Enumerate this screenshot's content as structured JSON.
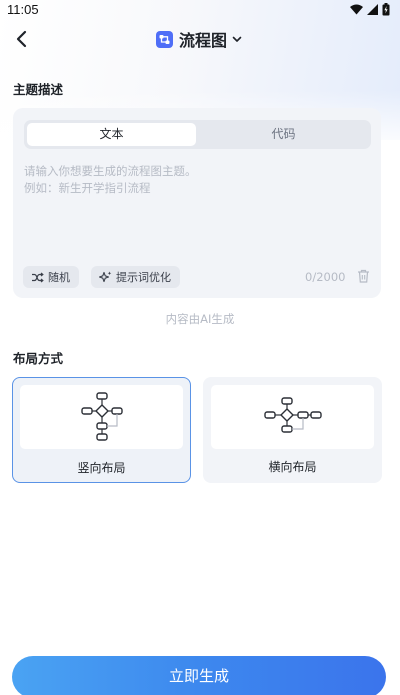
{
  "status_bar": {
    "time": "11:05"
  },
  "header": {
    "title": "流程图"
  },
  "topic": {
    "section_title": "主题描述",
    "tabs": [
      {
        "label": "文本"
      },
      {
        "label": "代码"
      }
    ],
    "placeholder_line1": "请输入你想要生成的流程图主题。",
    "placeholder_line2": "例如：新生开学指引流程",
    "chips": {
      "random": "随机",
      "optimize": "提示词优化"
    },
    "counter": "0/2000",
    "ai_note": "内容由AI生成"
  },
  "layout": {
    "section_title": "布局方式",
    "options": [
      {
        "label": "竖向布局"
      },
      {
        "label": "横向布局"
      }
    ],
    "selected": "竖向布局"
  },
  "generate_button": "立即生成",
  "colors": {
    "accent": "#3d88ee",
    "selected_border": "#5a93e6",
    "app_icon": "#4f6ef7"
  }
}
